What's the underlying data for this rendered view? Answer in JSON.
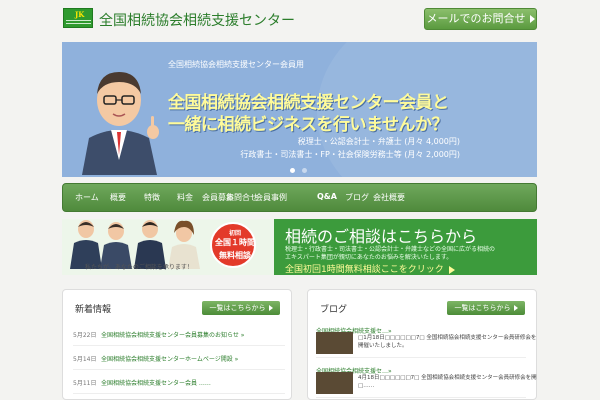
{
  "header": {
    "site_title": "全国相続協会相続支援センター",
    "logo_mark": "JK",
    "contact_label": "メールでのお問合せ",
    "colors": {
      "brand": "#2b7d2b",
      "button": "#5a9a3f"
    }
  },
  "hero": {
    "small_text": "全国相続協会相続支援センター会員用",
    "headline_line1": "全国相続協会相続支援センター会員と",
    "headline_line2": "一緒に相続ビジネスを行いませんか？",
    "sub_line1": "税理士・公認会計士・弁護士 (月々 4,000円)",
    "sub_line2": "行政書士・司法書士・FP・社会保険労務士等 (月々 2,000円)",
    "colors": {
      "bg": "#8fb1dc",
      "headline": "#fffb9a"
    }
  },
  "nav": {
    "items": [
      "ホーム",
      "概要",
      "特徴",
      "料金",
      "会員募集",
      "お問合せ",
      "会員事例",
      "Q&A",
      "ブログ",
      "会社概要"
    ]
  },
  "banner": {
    "title": "相続のご相談はこちらから",
    "desc_line1": "税理士・行政書士・司法書士・公認会計士・弁護士などの全国に広がる相続の",
    "desc_line2": "エキスパート集団が親切にあなたのお悩みを解決いたします。",
    "cta": "全国初回1時間無料相談ここをクリック",
    "badge_top": "初回",
    "badge_mid": "全国１時間",
    "badge_bottom": "無料相談",
    "caption": "私たちが、あなたのご相談を承ります！"
  },
  "news_panel": {
    "title": "新着情報",
    "list_button": "一覧はこちらから",
    "items": [
      {
        "date": "5月22日",
        "text": "全国相続協会相続支援センター会員募集のお知らせ »"
      },
      {
        "date": "5月14日",
        "text": "全国相続協会相続支援センターホームページ開設 »"
      },
      {
        "date": "5月11日",
        "text": "全国相続協会相続支援センター会員 ……"
      }
    ]
  },
  "blog_panel": {
    "title": "ブログ",
    "list_button": "一覧はこちらから",
    "items": [
      {
        "title": "全国相続協会相続支援セ…»",
        "excerpt_line1": "□1月18日□□□□□□7□ 全国相続協会相続支援センター会員研修会を",
        "excerpt_line2": "開催いたしました。"
      },
      {
        "title": "全国相続協会相続支援セ…»",
        "excerpt_line1": "4月18日□□□□□□7□ 全国相続協会相続支援センター会員研修会を開",
        "excerpt_line2": "□……"
      }
    ]
  }
}
